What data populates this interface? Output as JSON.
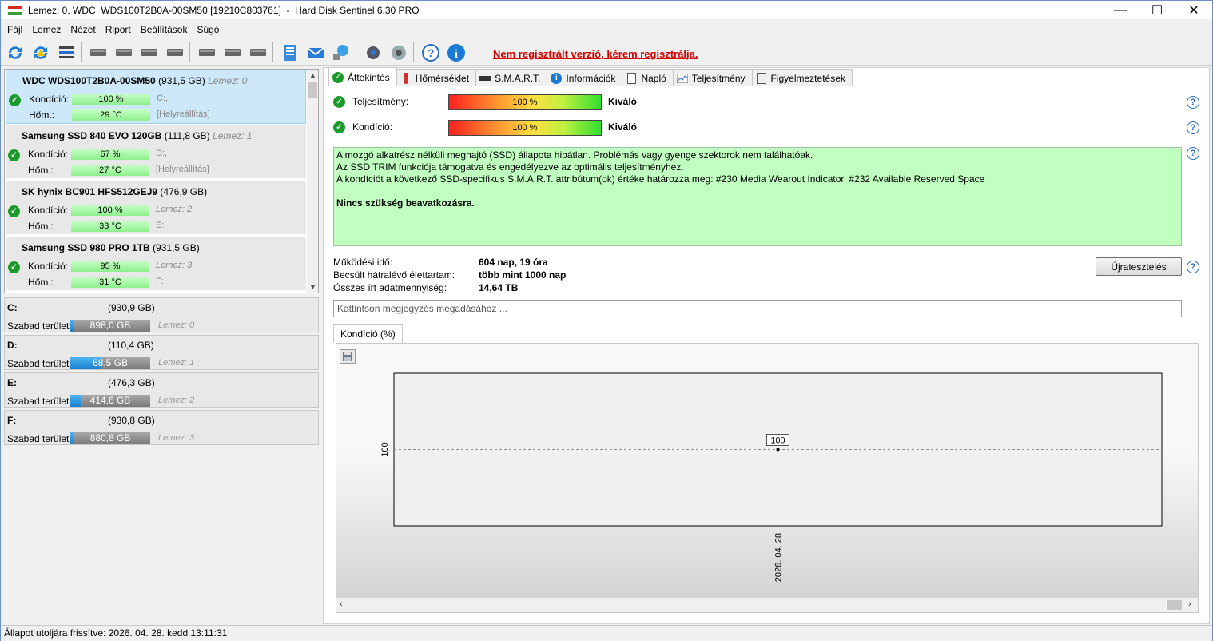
{
  "window": {
    "title": "Lemez: 0, WDC  WDS100T2B0A-00SM50 [19210C803761]  -  Hard Disk Sentinel 6.30 PRO",
    "controls": {
      "minimize": "—",
      "maximize": "☐",
      "close": "✕"
    }
  },
  "menu": [
    "Fájl",
    "Lemez",
    "Nézet",
    "Riport",
    "Beállítások",
    "Súgó"
  ],
  "toolbar": {
    "icons": [
      "refresh-icon",
      "refresh-warning-icon",
      "list-icon",
      "disk-test-icon",
      "disk-schedule-icon",
      "disk-check-icon",
      "disk-search-icon",
      "network-disk-icon",
      "disk-drive-icon",
      "server-icon",
      "notes-icon",
      "mail-icon",
      "network-icon",
      "gear-icon",
      "speaker-icon",
      "help-icon",
      "info-icon"
    ],
    "register_text": "Nem regisztrált verzió, kérem regisztrálja."
  },
  "disks": [
    {
      "name": "WDC  WDS100T2B0A-00SM50",
      "size": "(931,5 GB)",
      "disk": "Lemez: 0",
      "condition_label": "Kondíció:",
      "condition": "100 %",
      "temp_label": "Hőm.:",
      "temp": "29 °C",
      "drive": "C:,",
      "extra": "[Helyreállítás]",
      "selected": true
    },
    {
      "name": "Samsung SSD 840 EVO 120GB",
      "size": "(111,8 GB)",
      "disk": "Lemez: 1",
      "condition_label": "Kondíció:",
      "condition": "67 %",
      "temp_label": "Hőm.:",
      "temp": "27 °C",
      "drive": "D:,",
      "extra": "[Helyreállítás]"
    },
    {
      "name": "SK hynix BC901 HFS512GEJ9",
      "size": "(476,9 GB)",
      "disk": "",
      "condition_label": "Kondíció:",
      "condition": "100 %",
      "temp_label": "Hőm.:",
      "temp": "33 °C",
      "drive": "Lemez: 2",
      "extra": "E:"
    },
    {
      "name": "Samsung SSD 980 PRO 1TB",
      "size": "(931,5 GB)",
      "disk": "",
      "condition_label": "Kondíció:",
      "condition": "95 %",
      "temp_label": "Hőm.:",
      "temp": "31 °C",
      "drive": "Lemez: 3",
      "extra": "F:"
    }
  ],
  "drives": [
    {
      "letter": "C:",
      "size": "(930,9 GB)",
      "free_label": "Szabad terület",
      "free": "898,0 GB",
      "disk": "Lemez: 0",
      "used_fraction": 0.035
    },
    {
      "letter": "D:",
      "size": "(110,4 GB)",
      "free_label": "Szabad terület",
      "free": "68,5 GB",
      "disk": "Lemez: 1",
      "used_fraction": 0.38
    },
    {
      "letter": "E:",
      "size": "(476,3 GB)",
      "free_label": "Szabad terület",
      "free": "414,6 GB",
      "disk": "Lemez: 2",
      "used_fraction": 0.13
    },
    {
      "letter": "F:",
      "size": "(930,8 GB)",
      "free_label": "Szabad terület",
      "free": "880,8 GB",
      "disk": "Lemez: 3",
      "used_fraction": 0.054
    }
  ],
  "tabs": [
    "Áttekintés",
    "Hőmérséklet",
    "S.M.A.R.T.",
    "Információk",
    "Napló",
    "Teljesítmény",
    "Figyelmeztetések"
  ],
  "overview": {
    "performance_label": "Teljesítmény:",
    "performance_value": "100 %",
    "performance_status": "Kiváló",
    "condition_label": "Kondíció:",
    "condition_value": "100 %",
    "condition_status": "Kiváló",
    "info_lines": [
      "A mozgó alkatrész nélküli meghajtó (SSD) állapota hibátlan. Problémás vagy gyenge szektorok nem találhatóak.",
      "Az SSD TRIM funkciója támogatva és engedélyezve az optimális teljesítményhez.",
      "A kondíciót a következő SSD-specifikus S.M.A.R.T. attribútum(ok) értéke határozza meg:  #230 Media Wearout Indicator, #232 Available Reserved Space"
    ],
    "info_action": "Nincs szükség beavatkozásra.",
    "power_on_label": "Működési idő:",
    "power_on_value": "604 nap, 19 óra",
    "lifetime_label": "Becsült hátralévő élettartam:",
    "lifetime_value": "több mint 1000 nap",
    "written_label": "Összes írt adatmennyiség:",
    "written_value": "14,64 TB",
    "retest_button": "Újratesztelés",
    "notes_placeholder": "Kattintson megjegyzés megadásához ...",
    "help": "?"
  },
  "chart_tab": "Kondíció  (%)",
  "chart_data": {
    "type": "line",
    "x": [
      "2026. 04. 28."
    ],
    "y": [
      100
    ],
    "ytick_labels": [
      "100"
    ],
    "xtick_labels": [
      "2026. 04. 28."
    ],
    "data_labels": [
      "100"
    ],
    "grid": true
  },
  "status": "Állapot utoljára frissítve: 2026. 04. 28. kedd 13:11:31",
  "colors": {
    "accent": "#2a6dc8",
    "ok": "#1a9a2a",
    "warning_text": "#d40000",
    "info_bg": "#c0ffc0"
  }
}
